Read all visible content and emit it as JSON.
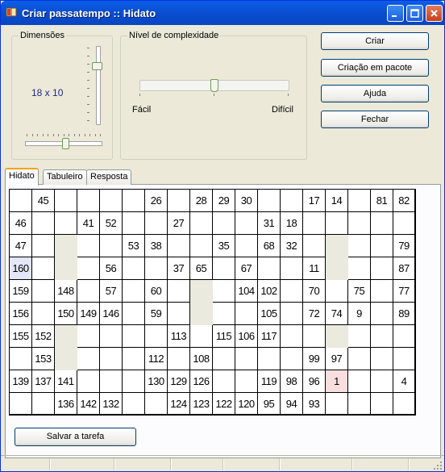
{
  "window": {
    "title": "Criar passatempo :: Hidato"
  },
  "dimensions": {
    "label": "Dimensões",
    "value": "18 x 10",
    "vertical_slider_level": 0.2,
    "horizontal_slider_level": 0.5
  },
  "complexity": {
    "label": "Nível de complexidade",
    "easy_label": "Fácil",
    "hard_label": "Difícil",
    "slider_level": 0.5
  },
  "buttons": {
    "create": "Criar",
    "batch": "Criação em pacote",
    "help": "Ajuda",
    "close": "Fechar",
    "save": "Salvar a tarefa"
  },
  "tabs": [
    {
      "label": "Hidato",
      "active": true
    },
    {
      "label": "Tabuleiro",
      "active": false
    },
    {
      "label": "Resposta",
      "active": false
    }
  ],
  "colors": {
    "title_gradient": "#0a5ee8",
    "blocked_cell": "#ebeadf",
    "start_cell": "#f8dede",
    "end_cell": "#e3e7f8",
    "dimension_value": "#1f2a8a"
  },
  "puzzle": {
    "cols": 18,
    "rows": 10,
    "start_value": "1",
    "end_value": "160",
    "grid": [
      [
        "",
        "45",
        "",
        "",
        "",
        "",
        "26",
        "",
        "28",
        "29",
        "30",
        "",
        "",
        "17",
        "14",
        "",
        "81",
        "82"
      ],
      [
        "46",
        "",
        "",
        "41",
        "52",
        "",
        "",
        "27",
        "",
        "",
        "",
        "31",
        "18",
        "",
        "",
        "",
        "",
        ""
      ],
      [
        "47",
        "",
        "#",
        "",
        "",
        "53",
        "38",
        "",
        "",
        "35",
        "",
        "68",
        "32",
        "",
        "#",
        "",
        "",
        "79"
      ],
      [
        "160",
        "",
        "#",
        "",
        "56",
        "",
        "",
        "37",
        "65",
        "",
        "67",
        "",
        "",
        "11",
        "#",
        "",
        "",
        "87"
      ],
      [
        "159",
        "",
        "148",
        "",
        "57",
        "",
        "60",
        "",
        "#",
        "",
        "104",
        "102",
        "",
        "70",
        "",
        "75",
        "",
        "77"
      ],
      [
        "156",
        "",
        "150",
        "149",
        "146",
        "",
        "59",
        "",
        "#",
        "",
        "",
        "105",
        "",
        "72",
        "74",
        "9",
        "",
        "89"
      ],
      [
        "155",
        "152",
        "#",
        "",
        "",
        "",
        "",
        "113",
        "",
        "115",
        "106",
        "117",
        "",
        "",
        "#",
        "",
        "",
        ""
      ],
      [
        "",
        "153",
        "#",
        "",
        "",
        "",
        "112",
        "",
        "108",
        "",
        "",
        "",
        "",
        "99",
        "97",
        "",
        "",
        ""
      ],
      [
        "139",
        "137",
        "141",
        "",
        "",
        "",
        "130",
        "129",
        "126",
        "",
        "",
        "119",
        "98",
        "96",
        "1",
        "",
        "",
        "4"
      ],
      [
        "",
        "",
        "136",
        "142",
        "132",
        "",
        "",
        "124",
        "123",
        "122",
        "120",
        "95",
        "94",
        "93",
        "",
        "",
        "",
        ""
      ]
    ]
  }
}
